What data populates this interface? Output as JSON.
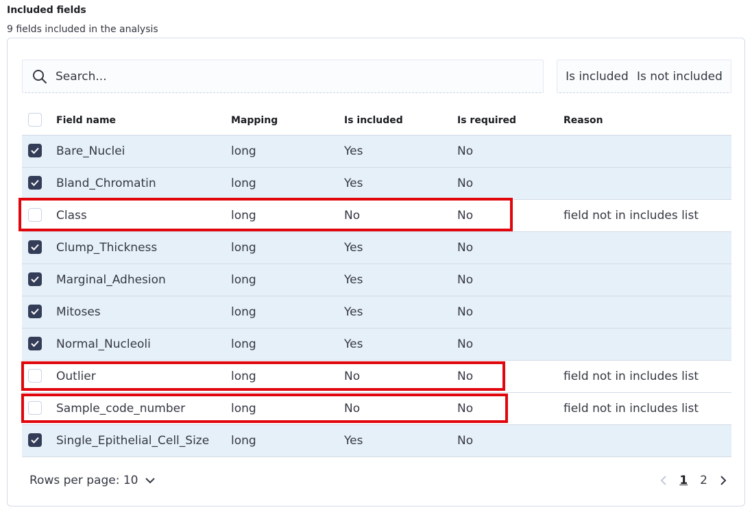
{
  "section": {
    "title": "Included fields",
    "description": "9 fields included in the analysis"
  },
  "search": {
    "placeholder": "Search..."
  },
  "filters": {
    "included_label": "Is included",
    "not_included_label": "Is not included"
  },
  "columns": {
    "field_name": "Field name",
    "mapping": "Mapping",
    "is_included": "Is included",
    "is_required": "Is required",
    "reason": "Reason"
  },
  "rows": [
    {
      "checked": true,
      "name": "Bare_Nuclei",
      "mapping": "long",
      "included": "Yes",
      "required": "No",
      "reason": ""
    },
    {
      "checked": true,
      "name": "Bland_Chromatin",
      "mapping": "long",
      "included": "Yes",
      "required": "No",
      "reason": ""
    },
    {
      "checked": false,
      "name": "Class",
      "mapping": "long",
      "included": "No",
      "required": "No",
      "reason": "field not in includes list"
    },
    {
      "checked": true,
      "name": "Clump_Thickness",
      "mapping": "long",
      "included": "Yes",
      "required": "No",
      "reason": ""
    },
    {
      "checked": true,
      "name": "Marginal_Adhesion",
      "mapping": "long",
      "included": "Yes",
      "required": "No",
      "reason": ""
    },
    {
      "checked": true,
      "name": "Mitoses",
      "mapping": "long",
      "included": "Yes",
      "required": "No",
      "reason": ""
    },
    {
      "checked": true,
      "name": "Normal_Nucleoli",
      "mapping": "long",
      "included": "Yes",
      "required": "No",
      "reason": ""
    },
    {
      "checked": false,
      "name": "Outlier",
      "mapping": "long",
      "included": "No",
      "required": "No",
      "reason": "field not in includes list"
    },
    {
      "checked": false,
      "name": "Sample_code_number",
      "mapping": "long",
      "included": "No",
      "required": "No",
      "reason": "field not in includes list"
    },
    {
      "checked": true,
      "name": "Single_Epithelial_Cell_Size",
      "mapping": "long",
      "included": "Yes",
      "required": "No",
      "reason": ""
    }
  ],
  "pagination": {
    "rows_per_page_label": "Rows per page: 10",
    "pages": [
      "1",
      "2"
    ],
    "current_page": "1"
  },
  "colors": {
    "selected_row": "#e6f0f8",
    "checkbox_checked": "#343d57",
    "highlight_annotation": "#e0060b"
  }
}
